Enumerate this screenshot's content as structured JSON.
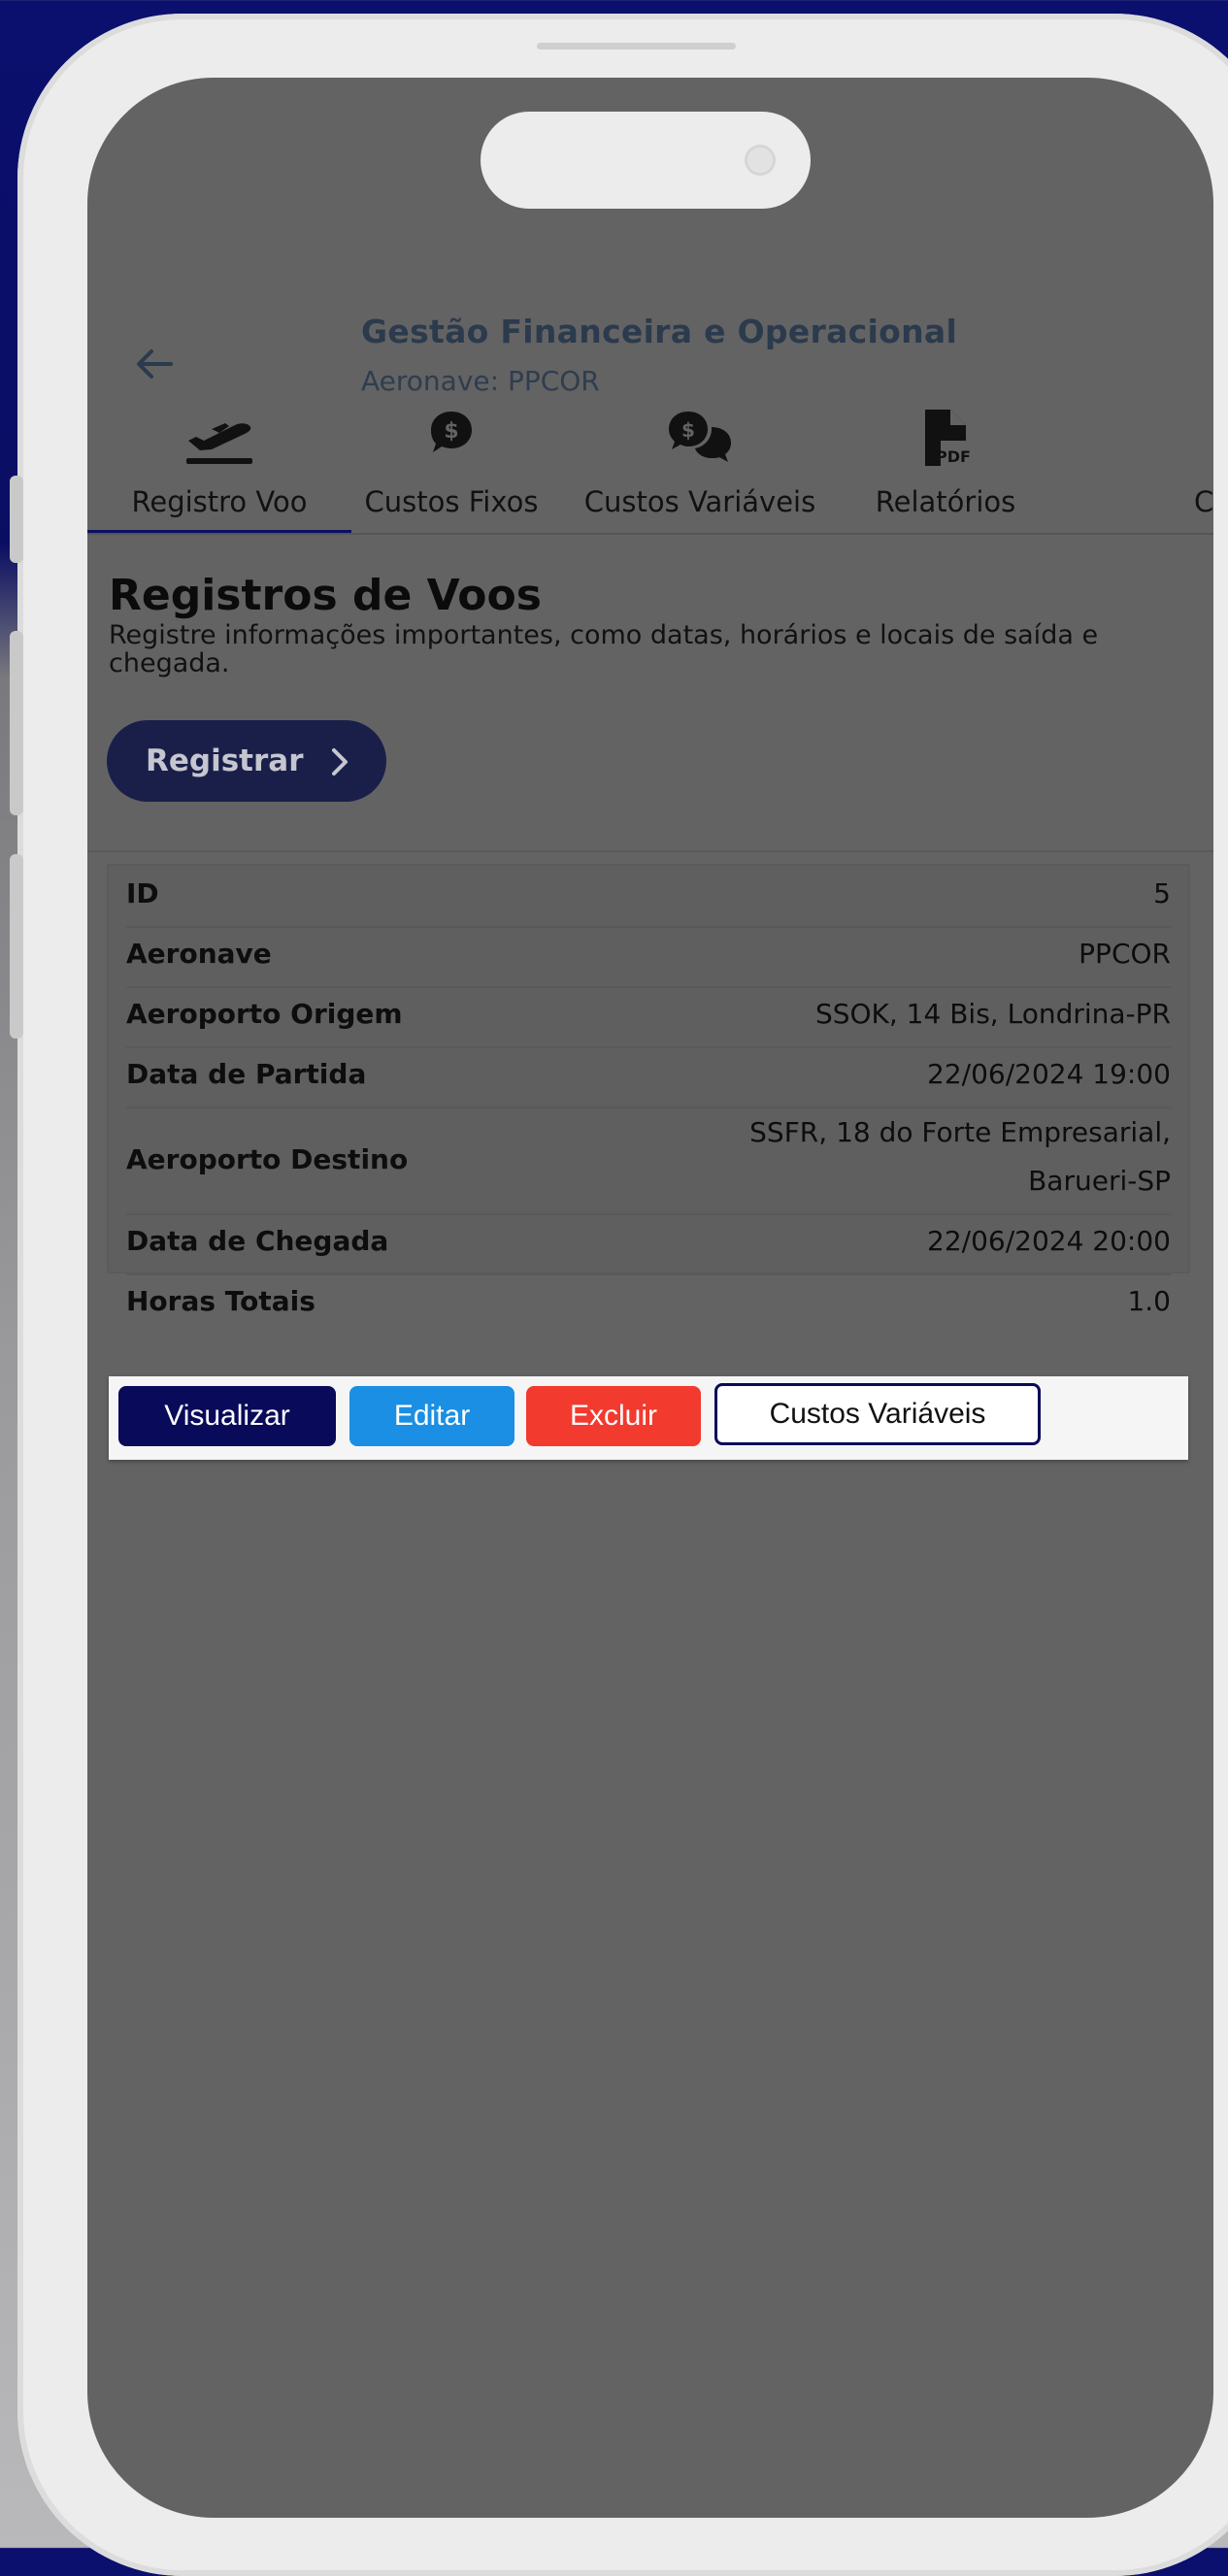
{
  "app": {
    "title": "Gestão Financeira e Operacional",
    "subtitle": "Aeronave: PPCOR"
  },
  "tabs": [
    {
      "label": "Registro Voo",
      "icon": "plane-departure-icon",
      "active": true
    },
    {
      "label": "Custos Fixos",
      "icon": "dollar-bubble-icon",
      "active": false
    },
    {
      "label": "Custos Variáveis",
      "icon": "dollar-chat-icon",
      "active": false
    },
    {
      "label": "Relatórios",
      "icon": "pdf-file-icon",
      "active": false
    },
    {
      "label": "C",
      "icon": "",
      "active": false
    }
  ],
  "section": {
    "title": "Registros de Voos",
    "description": "Registre informações importantes, como datas, horários e locais de saída e chegada.",
    "register_button": "Registrar"
  },
  "record": [
    {
      "label": "ID",
      "value": "5"
    },
    {
      "label": "Aeronave",
      "value": "PPCOR"
    },
    {
      "label": "Aeroporto Origem",
      "value": "SSOK, 14 Bis, Londrina-PR"
    },
    {
      "label": "Data de Partida",
      "value": "22/06/2024 19:00"
    },
    {
      "label": "Aeroporto Destino",
      "value_line1": "SSFR, 18 do Forte Empresarial,",
      "value_line2": "Barueri-SP"
    },
    {
      "label": "Data de Chegada",
      "value": "22/06/2024 20:00"
    },
    {
      "label": "Horas Totais",
      "value": "1.0"
    }
  ],
  "actions": {
    "view": "Visualizar",
    "edit": "Editar",
    "delete": "Excluir",
    "variable_costs": "Custos Variáveis"
  },
  "colors": {
    "primary": "#0a0a5a",
    "edit": "#1a8fe3",
    "delete": "#f23a2f",
    "overlay": "#636363"
  }
}
